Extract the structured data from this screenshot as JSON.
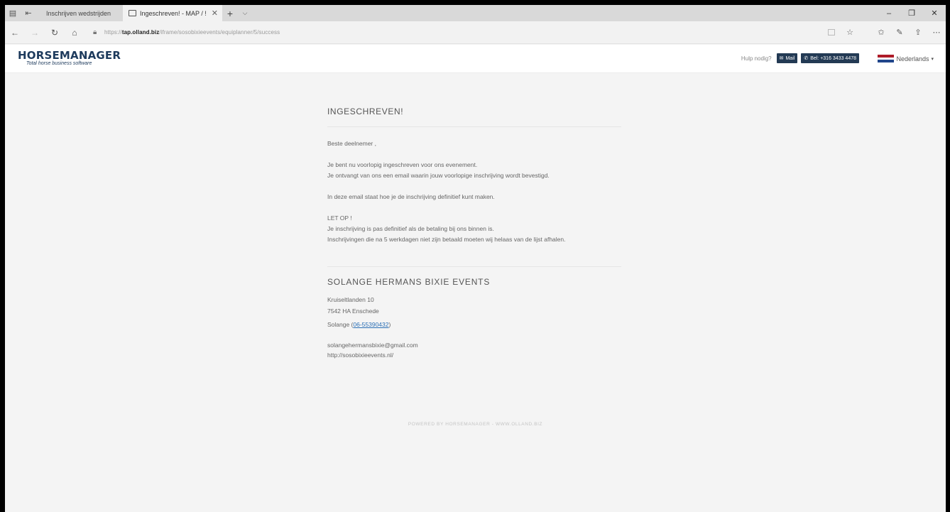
{
  "browser": {
    "tabs": [
      {
        "label": "Inschrijven wedstrijden"
      },
      {
        "label": "Ingeschreven! - MAP / !"
      }
    ],
    "url_prefix": "https://",
    "url_domain": "tap.olland.biz",
    "url_path": "/iframe/sosobixieevents/equiplanner/5/success"
  },
  "header": {
    "logo_main": "HORSEMANAGER",
    "logo_sub": "Total horse business software",
    "help_text": "Hulp nodig?",
    "mail_label": "Mail",
    "phone_label": "Bel: +316 3433 4478",
    "language": "Nederlands"
  },
  "main": {
    "title": "INGESCHREVEN!",
    "greeting": "Beste deelnemer ,",
    "lines_1": [
      "Je bent nu voorlopig ingeschreven voor ons evenement.",
      "Je ontvangt van ons een email waarin jouw voorlopige inschrijving wordt bevestigd."
    ],
    "line_2": "In deze email staat hoe je de inschrijving definitief kunt maken.",
    "lines_3": [
      "LET OP !",
      "Je inschrijving is pas definitief als de betaling bij ons binnen is.",
      "Inschrijvingen die na 5 werkdagen niet zijn betaald moeten wij helaas van de lijst afhalen."
    ]
  },
  "organization": {
    "name": "SOLANGE HERMANS BIXIE EVENTS",
    "street": "Kruiseltlanden 10",
    "city": "7542 HA Enschede",
    "contact_name": "Solange (",
    "contact_phone": "06-55390432",
    "contact_close": ")",
    "email": "solangehermansbixie@gmail.com",
    "website": "http://sosobixieevents.nl/"
  },
  "footer": {
    "text": "POWERED BY HORSEMANAGER - WWW.OLLAND.BIZ"
  },
  "colors": {
    "brand_navy": "#233a54",
    "link": "#2b6fb5"
  }
}
